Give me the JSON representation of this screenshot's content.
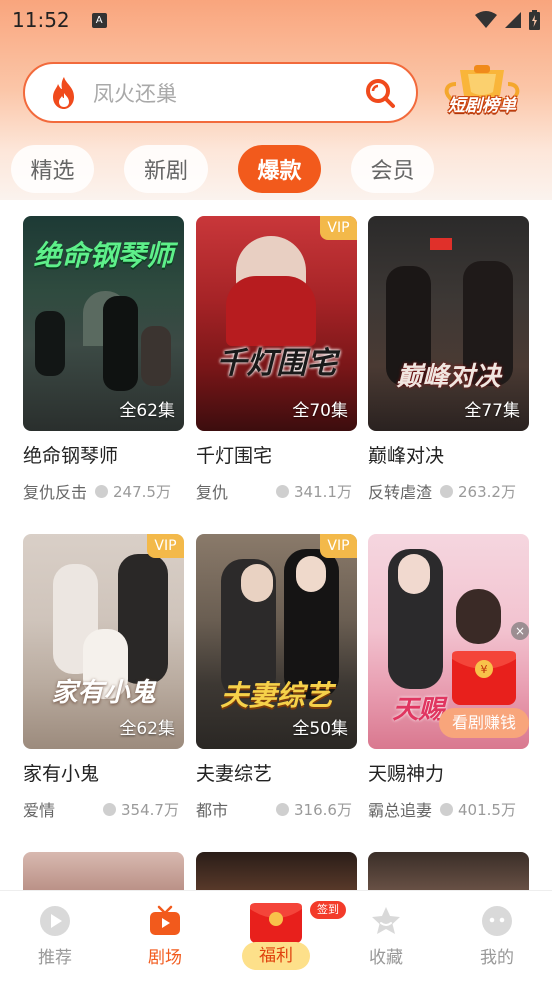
{
  "status": {
    "time": "11:52",
    "a_label": "A"
  },
  "search": {
    "placeholder": "凤火还巢"
  },
  "rank": {
    "label": "短剧榜单"
  },
  "tabs": [
    {
      "label": "精选"
    },
    {
      "label": "新剧"
    },
    {
      "label": "爆款"
    },
    {
      "label": "会员"
    }
  ],
  "dramas": [
    {
      "title": "绝命钢琴师",
      "poster_title": "绝命钢琴师",
      "episodes": "全62集",
      "vip": "",
      "tag": "复仇反击",
      "views": "247.5万"
    },
    {
      "title": "千灯围宅",
      "poster_title": "千灯围宅",
      "episodes": "全70集",
      "vip": "VIP",
      "tag": "复仇",
      "views": "341.1万"
    },
    {
      "title": "巅峰对决",
      "poster_title": "巅峰对决",
      "episodes": "全77集",
      "vip": "",
      "tag": "反转虐渣",
      "views": "263.2万"
    },
    {
      "title": "家有小鬼",
      "poster_title": "家有小鬼",
      "episodes": "全62集",
      "vip": "VIP",
      "tag": "爱情",
      "views": "354.7万"
    },
    {
      "title": "夫妻综艺",
      "poster_title": "夫妻综艺",
      "episodes": "全50集",
      "vip": "VIP",
      "tag": "都市",
      "views": "316.6万"
    },
    {
      "title": "天赐神力",
      "poster_title": "天赐",
      "episodes": "",
      "vip": "",
      "tag": "霸总追妻",
      "views": "401.5万"
    }
  ],
  "float_widget": {
    "label": "看剧赚钱",
    "close": "×"
  },
  "nav": {
    "items": [
      {
        "label": "推荐"
      },
      {
        "label": "剧场"
      },
      {
        "label": "福利"
      },
      {
        "label": "收藏"
      },
      {
        "label": "我的"
      }
    ],
    "sign_badge": "签到"
  },
  "colors": {
    "accent": "#f25a1c",
    "vip": "#f3b94a"
  }
}
